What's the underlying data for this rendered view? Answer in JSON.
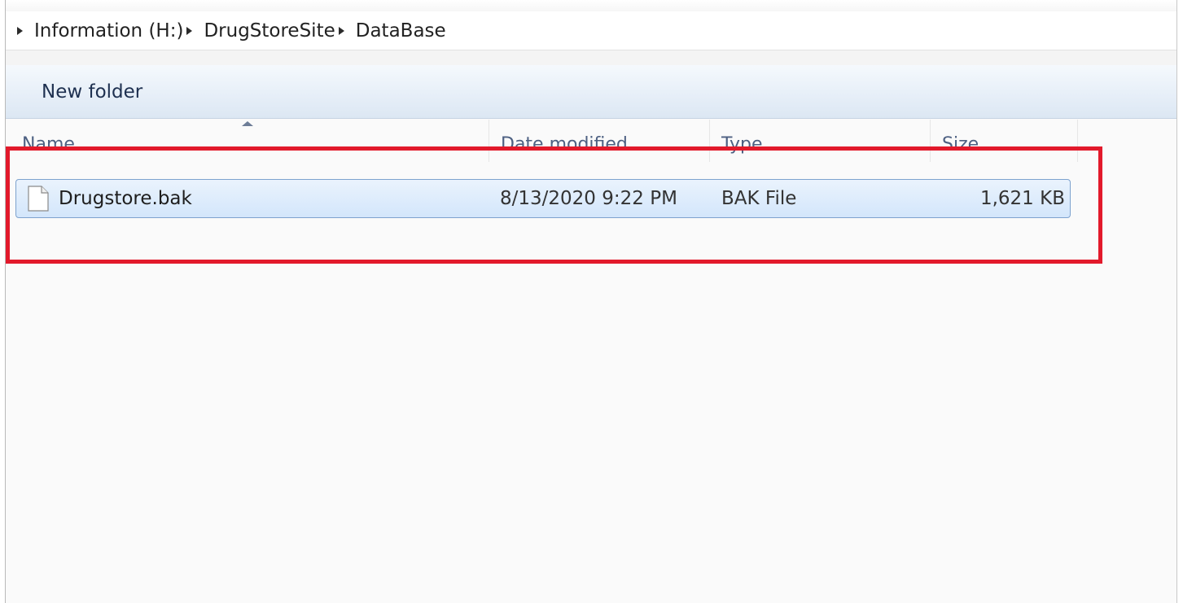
{
  "address_bar": {
    "crumbs": [
      "Information (H:)",
      "DrugStoreSite",
      "DataBase"
    ]
  },
  "toolbar": {
    "new_folder_label": "New folder"
  },
  "columns": {
    "name": "Name",
    "date_modified": "Date modified",
    "type": "Type",
    "size": "Size"
  },
  "files": [
    {
      "name": "Drugstore.bak",
      "date_modified": "8/13/2020 9:22 PM",
      "type": "BAK File",
      "size": "1,621 KB",
      "icon": "file-icon"
    }
  ],
  "colors": {
    "highlight_border": "#e2192b",
    "selection_border": "#7da2ce",
    "header_text": "#4d6082"
  }
}
